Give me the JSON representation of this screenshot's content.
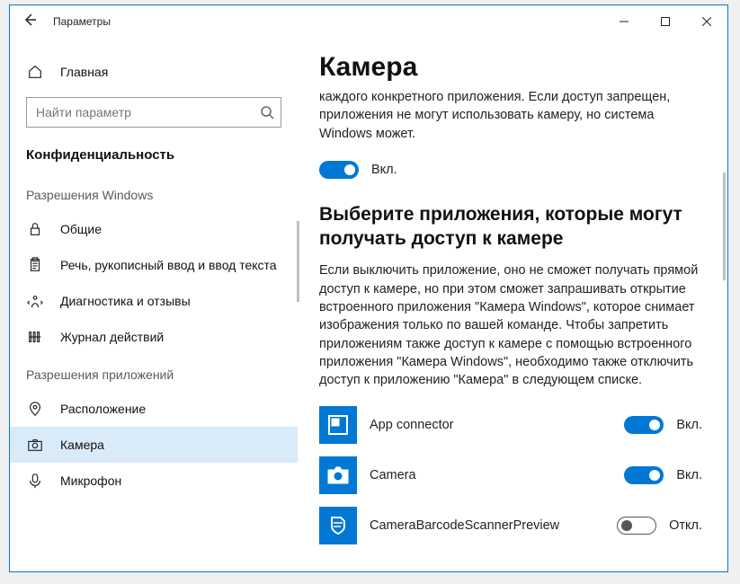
{
  "window": {
    "title": "Параметры"
  },
  "sidebar": {
    "home": "Главная",
    "search_placeholder": "Найти параметр",
    "category": "Конфиденциальность",
    "section_windows": "Разрешения Windows",
    "section_apps": "Разрешения приложений",
    "items_windows": [
      {
        "label": "Общие",
        "icon": "lock"
      },
      {
        "label": "Речь, рукописный ввод и ввод текста",
        "icon": "clipboard"
      },
      {
        "label": "Диагностика и отзывы",
        "icon": "feedback"
      },
      {
        "label": "Журнал действий",
        "icon": "activity"
      }
    ],
    "items_apps": [
      {
        "label": "Расположение",
        "icon": "location"
      },
      {
        "label": "Камера",
        "icon": "camera",
        "selected": true
      },
      {
        "label": "Микрофон",
        "icon": "microphone"
      }
    ]
  },
  "content": {
    "heading": "Камера",
    "lead": "каждого конкретного приложения. Если доступ запрещен, приложения не могут использовать камеру, но система Windows может.",
    "master_toggle": {
      "state": "on",
      "label": "Вкл."
    },
    "subheading": "Выберите приложения, которые могут получать доступ к камере",
    "desc": "Если выключить приложение, оно не сможет получать прямой доступ к камере, но при этом сможет запрашивать открытие встроенного приложения \"Камера Windows\", которое снимает изображения только по вашей команде. Чтобы запретить приложениям также доступ к камере с помощью встроенного приложения \"Камера Windows\", необходимо также отключить доступ к приложению \"Камера\" в следующем списке.",
    "apps": [
      {
        "name": "App connector",
        "state": "on",
        "state_label": "Вкл."
      },
      {
        "name": "Camera",
        "state": "on",
        "state_label": "Вкл."
      },
      {
        "name": "CameraBarcodeScannerPreview",
        "state": "off",
        "state_label": "Откл."
      }
    ]
  }
}
